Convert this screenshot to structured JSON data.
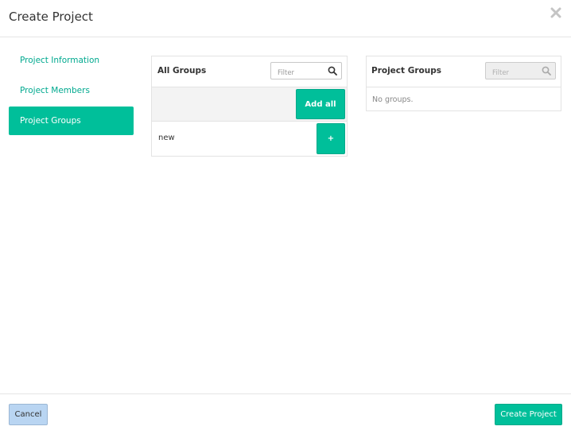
{
  "dialog": {
    "title": "Create Project",
    "close_icon": "close-icon"
  },
  "nav": {
    "items": [
      {
        "label": "Project Information",
        "active": false
      },
      {
        "label": "Project Members",
        "active": false
      },
      {
        "label": "Project Groups",
        "active": true
      }
    ]
  },
  "all_groups": {
    "title": "All Groups",
    "filter_placeholder": "Filter",
    "add_all_label": "Add all",
    "items": [
      {
        "name": "new",
        "add_label": "+"
      }
    ]
  },
  "project_groups": {
    "title": "Project Groups",
    "filter_placeholder": "Filter",
    "empty_text": "No groups."
  },
  "footer": {
    "cancel_label": "Cancel",
    "create_label": "Create Project"
  },
  "colors": {
    "accent": "#00bf9a",
    "link": "#00a98f",
    "cancel_bg": "#b9d5f2"
  }
}
